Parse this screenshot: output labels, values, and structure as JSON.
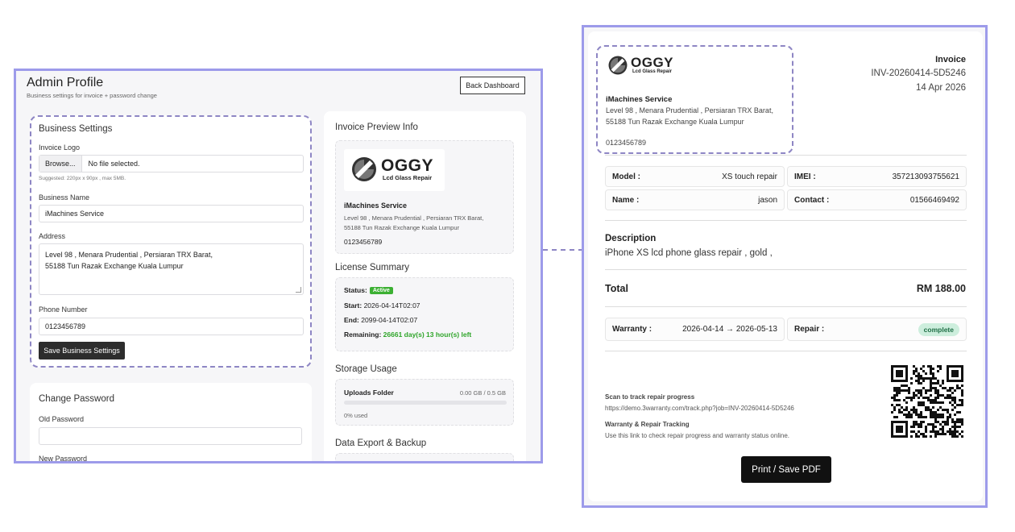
{
  "admin": {
    "title": "Admin Profile",
    "subtitle": "Business settings for invoice + password change",
    "back_label": "Back Dashboard",
    "business": {
      "heading": "Business Settings",
      "logo_label": "Invoice Logo",
      "browse_label": "Browse...",
      "file_status": "No file selected.",
      "logo_hint": "Suggested: 220px x 90px , max 5MB.",
      "name_label": "Business Name",
      "name_value": "iMachines Service",
      "address_label": "Address",
      "address_line1": "Level 98 , Menara Prudential , Persiaran TRX Barat,",
      "address_line2": "55188 Tun Razak Exchange Kuala Lumpur",
      "phone_label": "Phone Number",
      "phone_value": "0123456789",
      "save_label": "Save Business Settings"
    },
    "password": {
      "heading": "Change Password",
      "old_label": "Old Password",
      "new_label": "New Password"
    },
    "preview": {
      "heading": "Invoice Preview Info",
      "logo_word": "OGGY",
      "logo_tag": "Lcd Glass Repair",
      "name": "iMachines Service",
      "address_line1": "Level 98 , Menara Prudential , Persiaran TRX Barat,",
      "address_line2": "55188 Tun Razak Exchange Kuala Lumpur",
      "phone": "0123456789"
    },
    "license": {
      "heading": "License Summary",
      "status_label": "Status:",
      "status_value": "Active",
      "start_label": "Start:",
      "start_value": "2026-04-14T02:07",
      "end_label": "End:",
      "end_value": "2099-04-14T02:07",
      "remaining_label": "Remaining:",
      "remaining_value": "26661 day(s) 13 hour(s) left"
    },
    "storage": {
      "heading": "Storage Usage",
      "folder_label": "Uploads Folder",
      "usage_text": "0.00 GB / 0.5 GB",
      "percent_text": "0% used",
      "used_fraction": 0
    },
    "export": {
      "heading": "Data Export & Backup"
    }
  },
  "invoice": {
    "logo_word": "OGGY",
    "logo_tag": "Lcd Glass Repair",
    "business_name": "iMachines Service",
    "address_line1": "Level 98 , Menara Prudential , Persiaran TRX Barat,",
    "address_line2": "55188 Tun Razak Exchange Kuala Lumpur",
    "phone": "0123456789",
    "heading": "Invoice",
    "number": "INV-20260414-5D5246",
    "date": "14 Apr 2026",
    "model_label": "Model :",
    "model_value": "XS touch repair",
    "imei_label": "IMEI :",
    "imei_value": "357213093755621",
    "name_label": "Name :",
    "name_value": "jason",
    "contact_label": "Contact :",
    "contact_value": "01566469492",
    "description_label": "Description",
    "description_value": "iPhone XS lcd phone glass repair , gold ,",
    "total_label": "Total",
    "total_value": "RM 188.00",
    "warranty_label": "Warranty :",
    "warranty_value": "2026-04-14 → 2026-05-13",
    "repair_label": "Repair :",
    "repair_status": "complete",
    "scan_title": "Scan to track repair progress",
    "scan_url": "https://demo.3warranty.com/track.php?job=INV-20260414-5D5246",
    "tracking_title": "Warranty & Repair Tracking",
    "tracking_text": "Use this link to check repair progress and warranty status online.",
    "print_label": "Print / Save PDF"
  },
  "colors": {
    "frame": "#9d9bea",
    "active_green": "#3cb033",
    "remaining_green": "#2fa52a",
    "complete_bg": "#cdeedd",
    "complete_text": "#1f6f46"
  }
}
